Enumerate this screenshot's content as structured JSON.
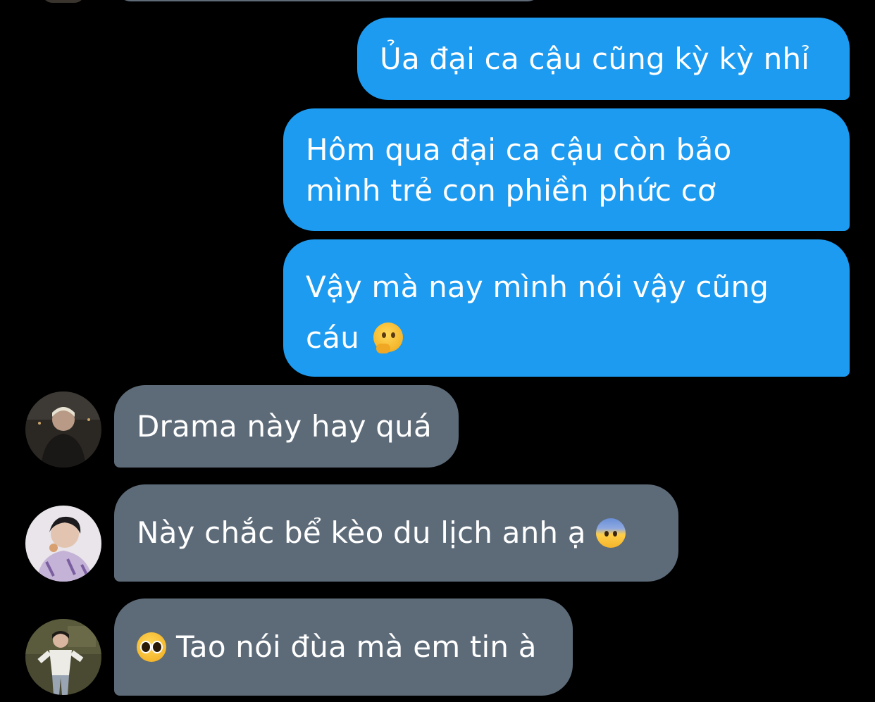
{
  "messages": [
    {
      "side": "outgoing",
      "text": "Ủa đại ca cậu cũng kỳ kỳ nhỉ"
    },
    {
      "side": "outgoing",
      "line1": "Hôm qua đại ca cậu còn bảo",
      "line2": "mình trẻ con phiền phức cơ"
    },
    {
      "side": "outgoing",
      "line1": "Vậy mà nay mình nói vậy cũng",
      "line2": "cáu",
      "emoji": "thinking-face"
    },
    {
      "side": "incoming",
      "text": "Drama này hay quá",
      "avatar": "avatar-user-1"
    },
    {
      "side": "incoming",
      "text": "Này chắc bể kèo du lịch anh ạ",
      "emoji": "anxious-face",
      "avatar": "avatar-user-2"
    },
    {
      "side": "incoming",
      "text": "Tao nói đùa mà em tin à",
      "emoji": "pleading-face",
      "avatar": "avatar-user-3"
    }
  ],
  "colors": {
    "background": "#000000",
    "outgoing_bubble": "#1d9bf0",
    "incoming_bubble": "#5d6b79",
    "text": "#ffffff"
  }
}
